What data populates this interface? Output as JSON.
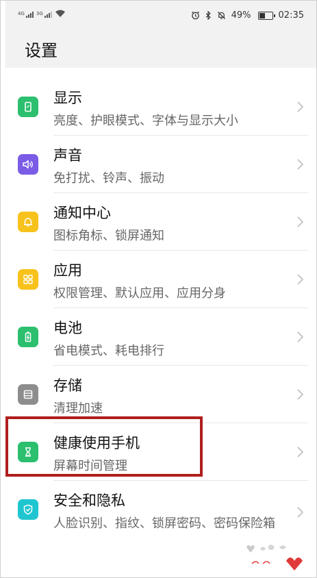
{
  "status_bar": {
    "sim1": "4G",
    "sim2": "3G",
    "battery": "49%",
    "battery_level": 0.49,
    "time": "02:35"
  },
  "page": {
    "title": "设置"
  },
  "items": [
    {
      "title": "显示",
      "subtitle": "亮度、护眼模式、字体与显示大小",
      "icon": "display-icon",
      "color": "#2bbf6e"
    },
    {
      "title": "声音",
      "subtitle": "免打扰、铃声、振动",
      "icon": "volume-icon",
      "color": "#7b5ce6"
    },
    {
      "title": "通知中心",
      "subtitle": "图标角标、锁屏通知",
      "icon": "bell-icon",
      "color": "#f7c21c"
    },
    {
      "title": "应用",
      "subtitle": "权限管理、默认应用、应用分身",
      "icon": "apps-grid-icon",
      "color": "#f7c21c"
    },
    {
      "title": "电池",
      "subtitle": "省电模式、耗电排行",
      "icon": "battery-icon",
      "color": "#2bbf6e"
    },
    {
      "title": "存储",
      "subtitle": "清理加速",
      "icon": "storage-icon",
      "color": "#8d8d8d"
    },
    {
      "title": "健康使用手机",
      "subtitle": "屏幕时间管理",
      "icon": "hourglass-icon",
      "color": "#2bbf6e"
    },
    {
      "title": "安全和隐私",
      "subtitle": "人脸识别、指纹、锁屏密码、密码保险箱",
      "icon": "shield-icon",
      "color": "#1fc6cf"
    }
  ],
  "highlight_color": "#b01e1e"
}
